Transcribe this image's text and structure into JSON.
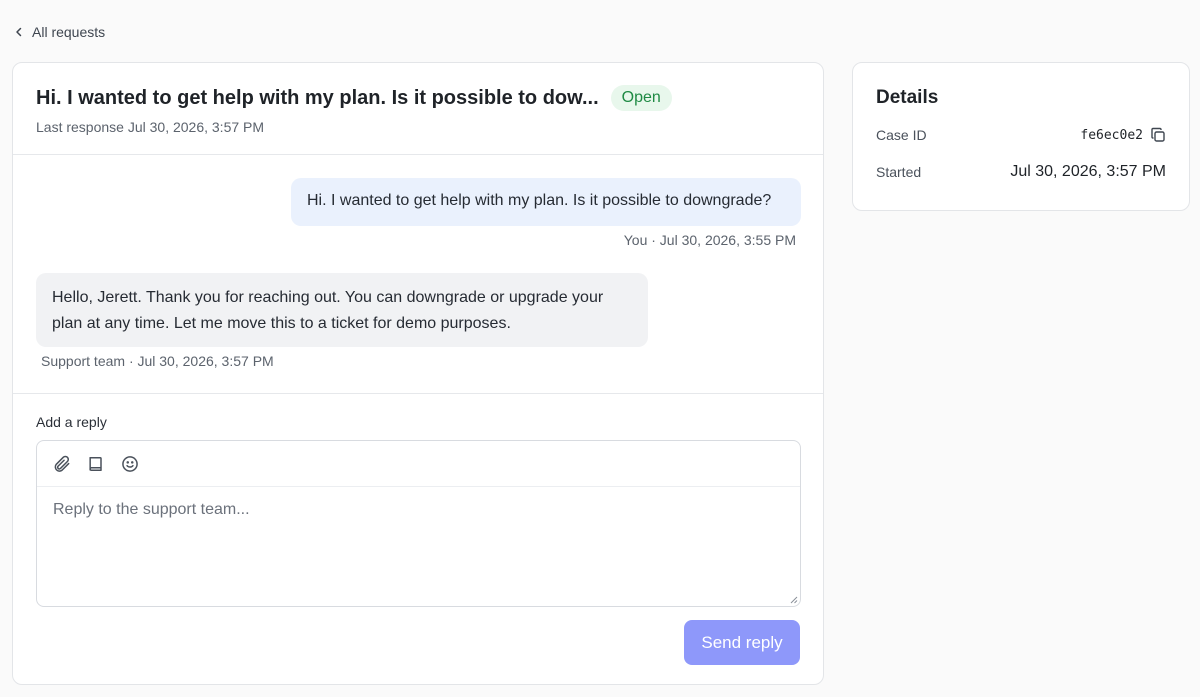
{
  "nav": {
    "back_label": "All requests"
  },
  "ticket": {
    "title": "Hi. I wanted to get help with my plan. Is it possible to dow...",
    "status": "Open",
    "last_response": "Last response Jul 30, 2026, 3:57 PM"
  },
  "messages": [
    {
      "text": "Hi. I wanted to get help with my plan. Is it possible to downgrade?",
      "meta": "You · Jul 30, 2026, 3:55 PM"
    },
    {
      "text": "Hello, Jerett. Thank you for reaching out. You can downgrade or upgrade your plan at any time. Let me move this to a ticket for demo purposes.",
      "meta": "Support team · Jul 30, 2026, 3:57 PM"
    }
  ],
  "reply": {
    "label": "Add a reply",
    "placeholder": "Reply to the support team...",
    "tools": [
      "paperclip-icon",
      "book-icon",
      "smiley-icon"
    ],
    "send_label": "Send reply"
  },
  "details": {
    "title": "Details",
    "case_id_label": "Case ID",
    "case_id": "fe6ec0e2",
    "started_label": "Started",
    "started": "Jul 30, 2026, 3:57 PM"
  },
  "colors": {
    "accent": "#8e98fa",
    "status_bg": "#e8f7ec",
    "status_text": "#1f8a44",
    "user_bubble": "#eaf1fd",
    "support_bubble": "#f1f2f4"
  }
}
